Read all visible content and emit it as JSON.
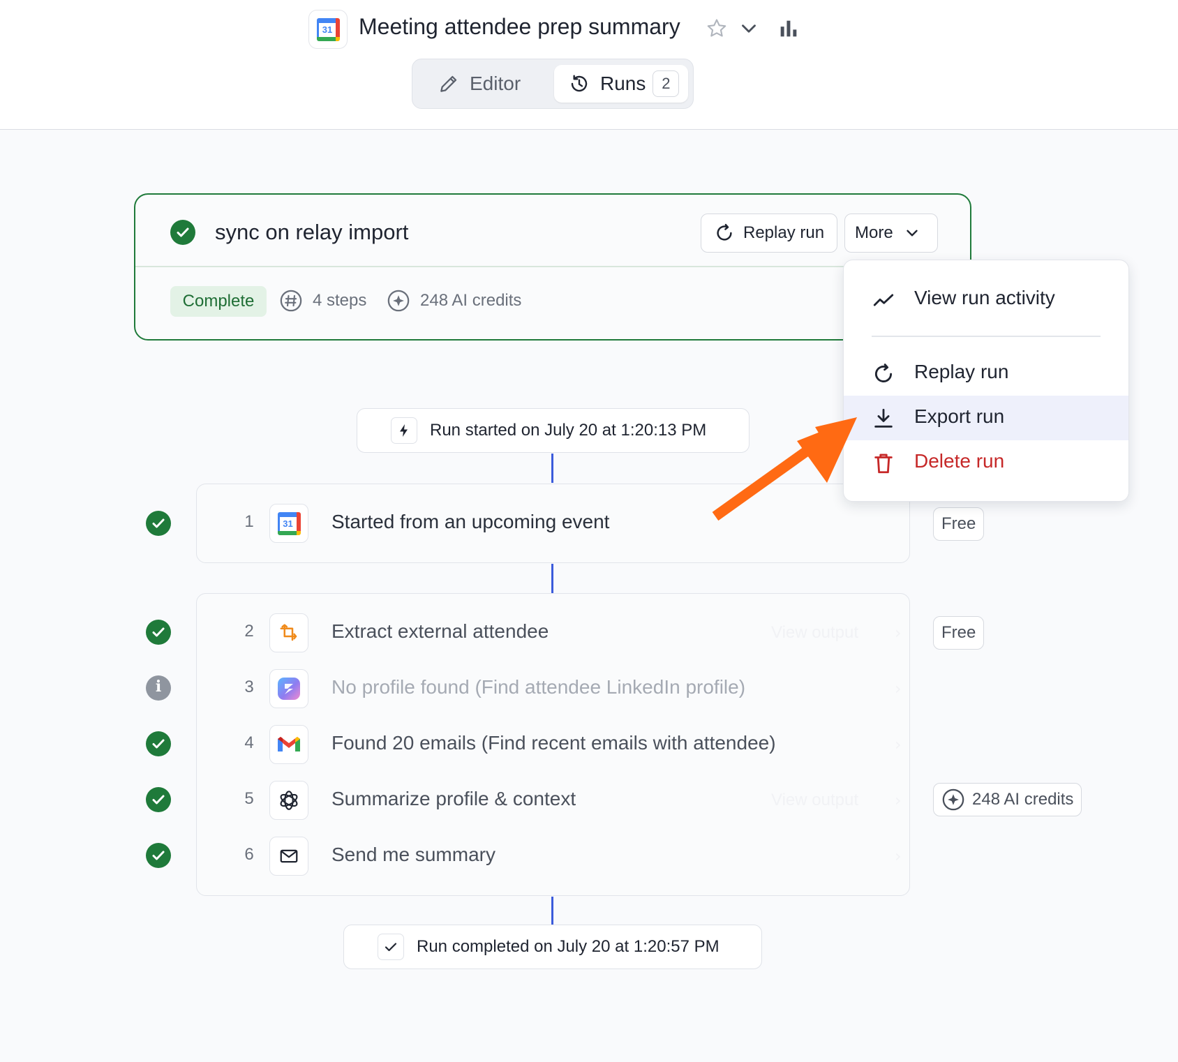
{
  "header": {
    "title": "Meeting attendee prep summary",
    "app_icon": "google-calendar-icon",
    "calendar_number": "31"
  },
  "tabs": [
    {
      "label": "Editor",
      "icon": "pencil-icon",
      "active": false
    },
    {
      "label": "Runs",
      "icon": "history-icon",
      "active": true,
      "count": "2"
    }
  ],
  "run": {
    "name": "sync on relay import",
    "status": "Complete",
    "steps_label": "4 steps",
    "credits_label": "248 AI credits",
    "replay_label": "Replay run",
    "more_label": "More"
  },
  "menu": {
    "items": [
      {
        "label": "View run activity",
        "icon": "activity-chart-icon"
      },
      {
        "label": "Replay run",
        "icon": "replay-icon"
      },
      {
        "label": "Export run",
        "icon": "download-icon",
        "highlighted": true
      },
      {
        "label": "Delete run",
        "icon": "trash-icon",
        "danger": true
      }
    ]
  },
  "timeline": {
    "started": "Run started on July 20 at 1:20:13 PM",
    "completed": "Run completed on July 20 at 1:20:57 PM"
  },
  "steps": [
    {
      "num": "1",
      "label": "Started from an upcoming event",
      "icon": "google-calendar-icon",
      "status": "success",
      "cost": "Free"
    },
    {
      "num": "2",
      "label": "Extract external attendee",
      "icon": "transform-icon",
      "status": "success",
      "cost": "Free"
    },
    {
      "num": "3",
      "label": "No profile found (Find attendee LinkedIn profile)",
      "icon": "relay-logo-icon",
      "status": "info",
      "cost": ""
    },
    {
      "num": "4",
      "label": "Found 20 emails (Find recent emails with attendee)",
      "icon": "gmail-icon",
      "status": "success",
      "cost": ""
    },
    {
      "num": "5",
      "label": "Summarize profile & context",
      "icon": "openai-icon",
      "status": "success",
      "cost": "248 AI credits"
    },
    {
      "num": "6",
      "label": "Send me summary",
      "icon": "mail-icon",
      "status": "success",
      "cost": ""
    }
  ],
  "colors": {
    "success": "#1f7a3a",
    "accent_line": "#3b5bdb",
    "danger": "#c62828",
    "annotation_arrow": "#ff6a13"
  }
}
